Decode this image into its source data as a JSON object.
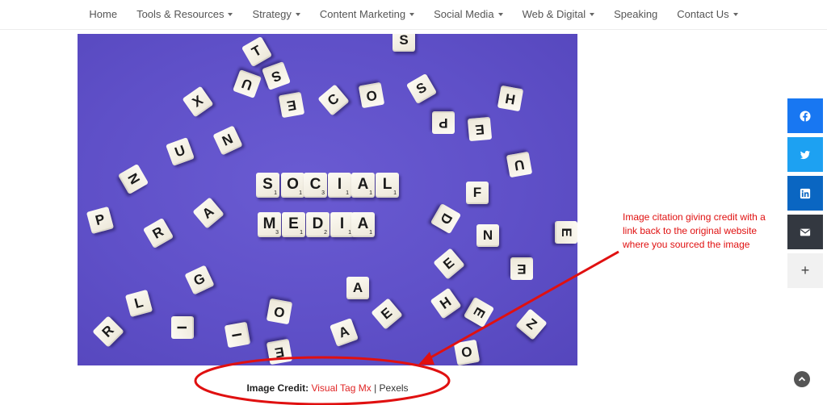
{
  "nav": {
    "items": [
      {
        "label": "Home",
        "dropdown": false
      },
      {
        "label": "Tools & Resources",
        "dropdown": true
      },
      {
        "label": "Strategy",
        "dropdown": true
      },
      {
        "label": "Content Marketing",
        "dropdown": true
      },
      {
        "label": "Social Media",
        "dropdown": true
      },
      {
        "label": "Web & Digital",
        "dropdown": true
      },
      {
        "label": "Speaking",
        "dropdown": false
      },
      {
        "label": "Contact Us",
        "dropdown": true
      }
    ]
  },
  "hero": {
    "word1": [
      {
        "l": "S",
        "n": "1"
      },
      {
        "l": "O",
        "n": "1"
      },
      {
        "l": "C",
        "n": "3"
      },
      {
        "l": "I",
        "n": "1"
      },
      {
        "l": "A",
        "n": "1"
      },
      {
        "l": "L",
        "n": "1"
      }
    ],
    "word2": [
      {
        "l": "M",
        "n": "3"
      },
      {
        "l": "E",
        "n": "1"
      },
      {
        "l": "D",
        "n": "2"
      },
      {
        "l": "I",
        "n": "1"
      },
      {
        "l": "A",
        "n": "1"
      }
    ],
    "scattered": [
      "T",
      "S",
      "U",
      "S",
      "X",
      "E",
      "C",
      "O",
      "S",
      "H",
      "P",
      "E",
      "U",
      "N",
      "N",
      "U",
      "F",
      "P",
      "R",
      "A",
      "D",
      "E",
      "N",
      "G",
      "L",
      "E",
      "E",
      "A",
      "R",
      "I",
      "I",
      "O",
      "A",
      "E",
      "H",
      "E",
      "Z",
      "O",
      "E"
    ]
  },
  "caption": {
    "label": "Image Credit:",
    "link_text": "Visual Tag Mx",
    "separator": " | ",
    "source": "Pexels"
  },
  "annotation": {
    "note": "Image citation giving credit with a link back to the original website where you sourced the image",
    "color": "#e01010"
  },
  "share": {
    "facebook_icon": "facebook-icon",
    "twitter_icon": "twitter-icon",
    "linkedin_icon": "linkedin-icon",
    "email_icon": "email-icon",
    "more_label": "+"
  },
  "colors": {
    "accent_link": "#e02424",
    "hero_bg": "#5f50c8",
    "facebook": "#1877f2",
    "twitter": "#1da1f2",
    "linkedin": "#0a66c2",
    "email": "#333840"
  }
}
